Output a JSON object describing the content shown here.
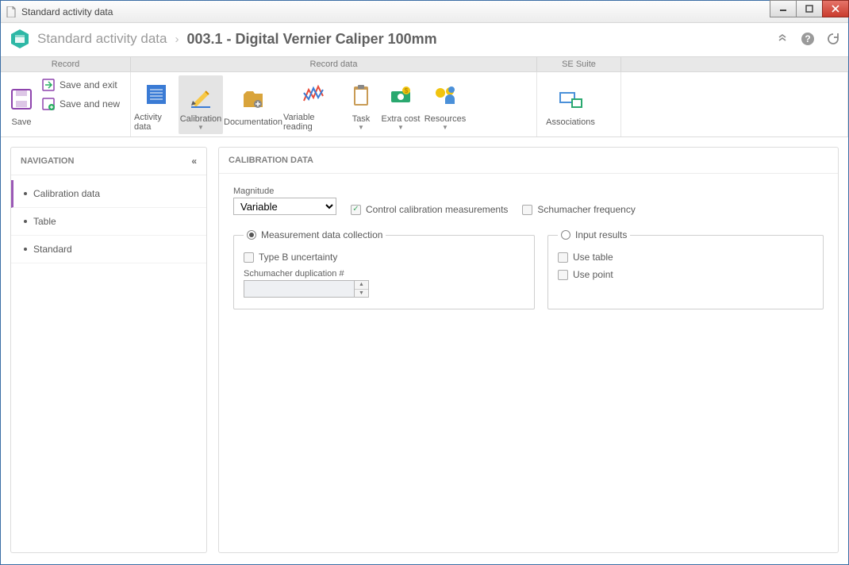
{
  "window": {
    "title": "Standard activity data"
  },
  "breadcrumb": {
    "root": "Standard activity data",
    "title": "003.1 - Digital Vernier Caliper 100mm"
  },
  "ribbon_groups": {
    "record": "Record",
    "record_data": "Record data",
    "se_suite": "SE Suite"
  },
  "ribbon": {
    "save": "Save",
    "save_exit": "Save and exit",
    "save_new": "Save and new",
    "activity_data": "Activity data",
    "calibration": "Calibration",
    "documentation": "Documentation",
    "variable_reading": "Variable reading",
    "task": "Task",
    "extra_cost": "Extra cost",
    "resources": "Resources",
    "associations": "Associations"
  },
  "nav": {
    "header": "NAVIGATION",
    "items": [
      "Calibration data",
      "Table",
      "Standard"
    ]
  },
  "form": {
    "header": "CALIBRATION DATA",
    "magnitude_label": "Magnitude",
    "magnitude_value": "Variable",
    "control_measurements": "Control calibration measurements",
    "schumacher_frequency": "Schumacher frequency",
    "measurement_legend": "Measurement data collection",
    "type_b": "Type B uncertainty",
    "schumacher_dup_label": "Schumacher duplication #",
    "input_results_legend": "Input results",
    "use_table": "Use table",
    "use_point": "Use point"
  }
}
